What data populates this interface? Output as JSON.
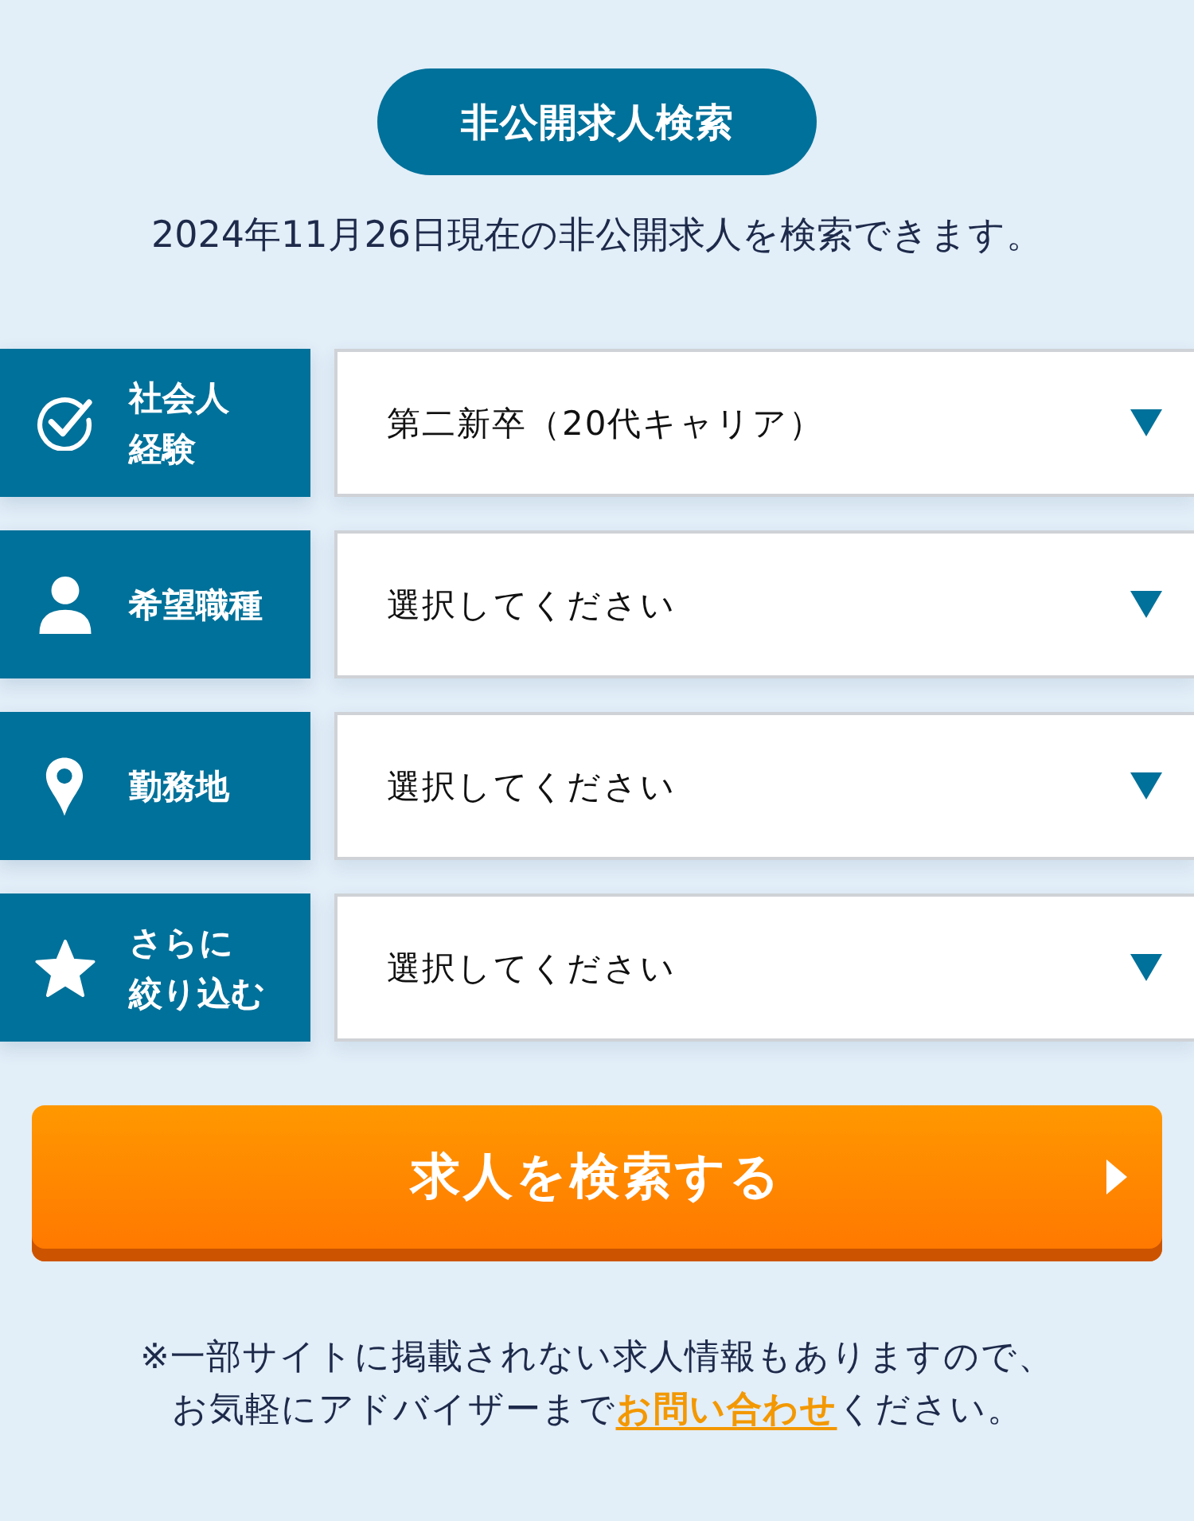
{
  "header": {
    "title": "非公開求人検索",
    "subtitle": "2024年11月26日現在の非公開求人を検索できます。"
  },
  "filters": [
    {
      "kind": "check",
      "label_lines": [
        "社会人",
        "経験"
      ],
      "value": "第二新卒（20代キャリア）"
    },
    {
      "kind": "person",
      "label_lines": [
        "希望職種"
      ],
      "value": "選択してください"
    },
    {
      "kind": "pin",
      "label_lines": [
        "勤務地"
      ],
      "value": "選択してください"
    },
    {
      "kind": "star",
      "label_lines": [
        "さらに",
        "絞り込む"
      ],
      "value": "選択してください"
    }
  ],
  "search_button": {
    "label": "求人を検索する"
  },
  "notice": {
    "line_1": "※一部サイトに掲載されない求人情報もありますので、",
    "line_2_before": "お気軽にアドバイザーまで",
    "link": "お問い合わせ",
    "line_2_after": "ください。"
  }
}
